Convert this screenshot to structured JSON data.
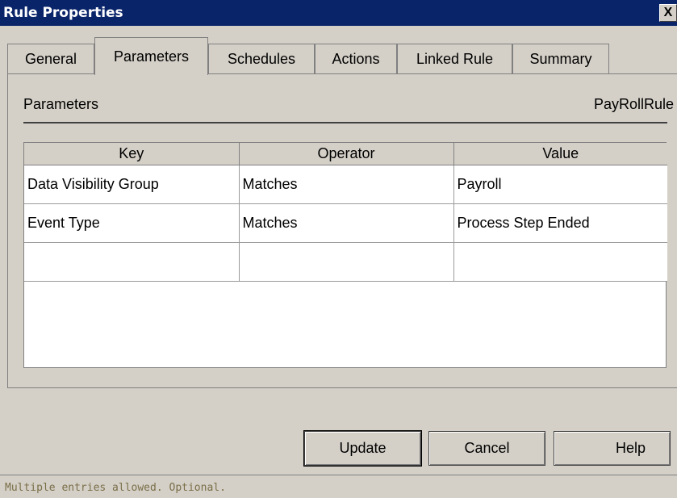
{
  "window": {
    "title": "Rule Properties",
    "close_glyph": "X"
  },
  "tabs": [
    {
      "label": "General",
      "active": false
    },
    {
      "label": "Parameters",
      "active": true
    },
    {
      "label": "Schedules",
      "active": false
    },
    {
      "label": "Actions",
      "active": false
    },
    {
      "label": "Linked Rule",
      "active": false
    },
    {
      "label": "Summary",
      "active": false
    }
  ],
  "section": {
    "title": "Parameters",
    "rule_name": "PayRollRule"
  },
  "grid": {
    "columns": [
      "Key",
      "Operator",
      "Value"
    ],
    "rows": [
      [
        "Data Visibility Group",
        "Matches",
        "Payroll"
      ],
      [
        "Event Type",
        "Matches",
        "Process Step Ended"
      ],
      [
        "",
        "",
        ""
      ]
    ]
  },
  "buttons": {
    "update": "Update",
    "cancel": "Cancel",
    "help": "Help"
  },
  "status": {
    "text": "Multiple entries allowed. Optional."
  }
}
